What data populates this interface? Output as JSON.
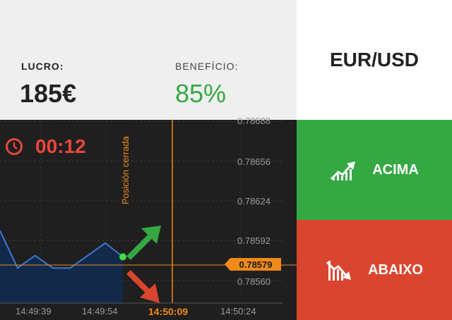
{
  "header": {
    "profit_label": "LUCRO:",
    "profit_value": "185€",
    "benefit_label": "BENEFÍCIO:",
    "benefit_value": "85%",
    "pair": "EUR/USD"
  },
  "timer": {
    "value": "00:12",
    "icon": "clock-icon"
  },
  "chart_data": {
    "type": "area",
    "y_ticks": [
      "0.78688",
      "0.78656",
      "0.78624",
      "0.78592",
      "0.78560"
    ],
    "x_ticks": [
      "14:49:39",
      "14:49:54",
      "14:50:09",
      "14:50:24"
    ],
    "current_price": "0.78579",
    "closed_label": "Posición cerrada",
    "highlight_time": "14:50:09",
    "x_times": [
      "14:49:39",
      "14:49:42",
      "14:49:45",
      "14:49:48",
      "14:49:51",
      "14:49:54",
      "14:49:57",
      "14:50:00"
    ],
    "y": [
      0.786,
      0.7857,
      0.7858,
      0.7857,
      0.7857,
      0.7858,
      0.7859,
      0.78579
    ],
    "ylim": [
      0.78552,
      0.78688
    ]
  },
  "buttons": {
    "up_label": "ACIMA",
    "down_label": "ABAIXO",
    "up_color": "#35a844",
    "down_color": "#d9452e"
  }
}
